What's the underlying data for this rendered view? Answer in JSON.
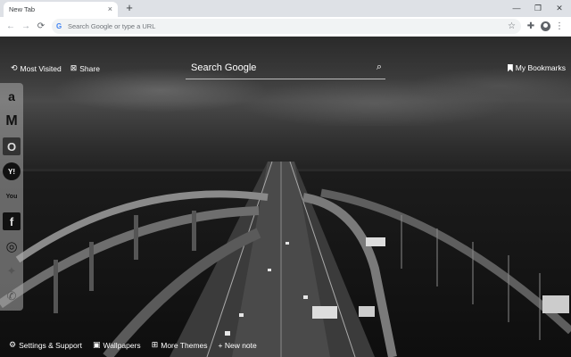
{
  "browser": {
    "tab_title": "New Tab",
    "tab_close": "×",
    "new_tab": "+",
    "omnibox_placeholder": "Search Google or type a URL",
    "back_icon": "←",
    "forward_icon": "→",
    "reload_icon": "⟳",
    "minimize": "—",
    "restore": "❐",
    "close": "✕"
  },
  "newtab": {
    "most_visited": "Most Visited",
    "share": "Share",
    "search_label": "Search Google",
    "my_bookmarks": "My Bookmarks",
    "sidebar_items": [
      {
        "name": "amazon",
        "glyph": "a"
      },
      {
        "name": "gmail",
        "glyph": "M"
      },
      {
        "name": "outlook",
        "glyph": "O"
      },
      {
        "name": "yahoo",
        "glyph": "Y!"
      },
      {
        "name": "youtube",
        "glyph": "You"
      },
      {
        "name": "facebook",
        "glyph": "f"
      },
      {
        "name": "instagram",
        "glyph": "◎"
      },
      {
        "name": "twitter",
        "glyph": "✦"
      },
      {
        "name": "whatsapp",
        "glyph": "✆"
      }
    ],
    "bottom_links": {
      "settings": "Settings & Support",
      "wallpapers": "Wallpapers",
      "more_themes": "More Themes",
      "new_note": "+ New note"
    }
  }
}
